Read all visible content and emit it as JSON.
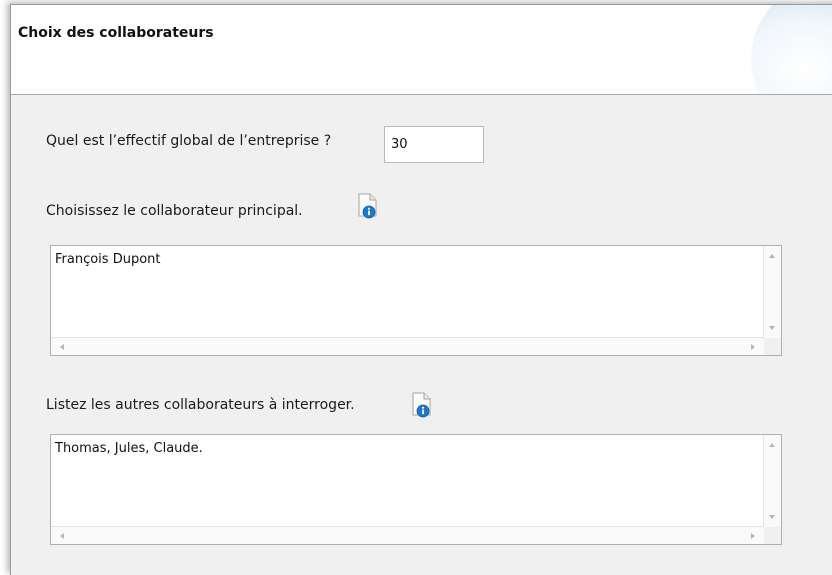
{
  "header": {
    "title": "Choix des collaborateurs"
  },
  "fields": {
    "effectif": {
      "label": "Quel est l’effectif global de l’entreprise ?",
      "value": "30"
    },
    "principal": {
      "label": "Choisissez le collaborateur principal.",
      "value": "François Dupont",
      "icon": "info-document-icon"
    },
    "autres": {
      "label": "Listez les autres collaborateurs à interroger.",
      "value": "Thomas, Jules, Claude.",
      "icon": "info-document-icon"
    }
  },
  "colors": {
    "info_badge": "#1e78c8",
    "header_accent": "#a9c8e6"
  }
}
